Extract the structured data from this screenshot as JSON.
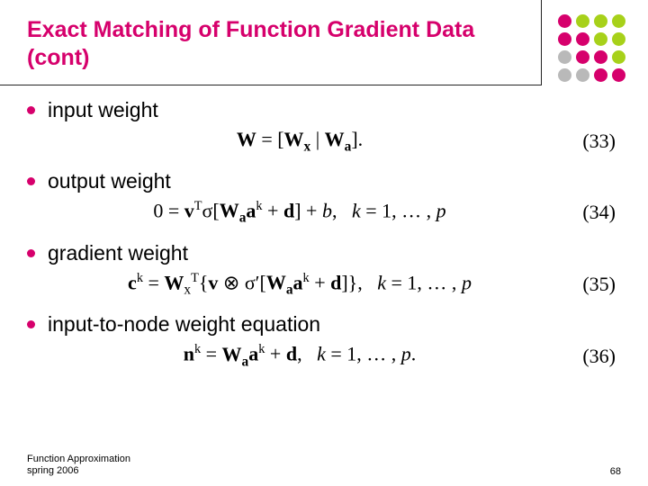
{
  "title": "Exact Matching of Function Gradient Data (cont)",
  "dots": [
    {
      "c": "#d6006c"
    },
    {
      "c": "#a7d11a"
    },
    {
      "c": "#a7d11a"
    },
    {
      "c": "#a7d11a"
    },
    {
      "c": "#d6006c"
    },
    {
      "c": "#d6006c"
    },
    {
      "c": "#a7d11a"
    },
    {
      "c": "#a7d11a"
    },
    {
      "c": "#b9b9b9"
    },
    {
      "c": "#d6006c"
    },
    {
      "c": "#d6006c"
    },
    {
      "c": "#a7d11a"
    },
    {
      "c": "#b9b9b9"
    },
    {
      "c": "#b9b9b9"
    },
    {
      "c": "#d6006c"
    },
    {
      "c": "#d6006c"
    }
  ],
  "items": [
    {
      "label": "input weight",
      "eq_html": "<b class='mat'>W</b> = [<b class='mat'>W<sub>x</sub></b> | <b class='mat'>W<sub>a</sub></b>].",
      "eqnum": "(33)"
    },
    {
      "label": "output weight",
      "eq_html": "0 = <b class='mat'>v</b><sup>T</sup>&sigma;[<b class='mat'>W<sub>a</sub></b><b class='mat'>a</b><sup>k</sup> + <b class='mat'>d</b>] + <i>b</i>,&nbsp;&nbsp;&nbsp;<i>k</i> = 1, &hellip; , <i>p</i>",
      "eqnum": "(34)"
    },
    {
      "label": "gradient weight",
      "eq_html": "<b class='mat'>c</b><sup>k</sup> = <b class='mat'>W</b><sub>x</sub><sup>T</sup>{<b class='mat'>v</b> &otimes; &sigma;&prime;[<b class='mat'>W<sub>a</sub></b><b class='mat'>a</b><sup>k</sup> + <b class='mat'>d</b>]},&nbsp;&nbsp;&nbsp;<i>k</i> = 1, &hellip; , <i>p</i>",
      "eqnum": "(35)"
    },
    {
      "label": "input-to-node weight equation",
      "eq_html": "<b class='mat'>n</b><sup>k</sup> = <b class='mat'>W<sub>a</sub></b><b class='mat'>a</b><sup>k</sup> + <b class='mat'>d</b>,&nbsp;&nbsp;&nbsp;<i>k</i> = 1, &hellip; , <i>p</i>.",
      "eqnum": "(36)"
    }
  ],
  "footer": {
    "left_line1": "Function Approximation",
    "left_line2": "spring 2006",
    "page": "68"
  }
}
